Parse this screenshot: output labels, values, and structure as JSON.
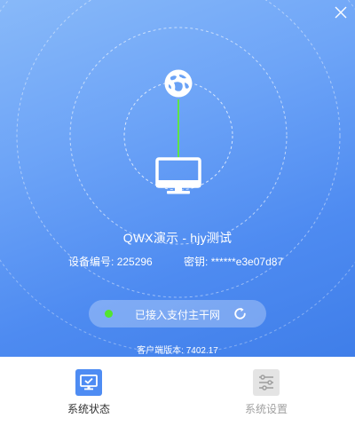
{
  "window": {
    "close_icon": "close-icon"
  },
  "connection": {
    "device_name": "QWX演示 - hjy测试",
    "device_id_label": "设备编号:",
    "device_id_value": "225296",
    "key_label": "密钥:",
    "key_value": "******e3e07d87",
    "status_text": "已接入支付主干网",
    "status_color": "#52e52f",
    "link_color": "#5de34a",
    "icons": {
      "network": "globe-icon",
      "device": "monitor-icon",
      "refresh": "refresh-icon"
    }
  },
  "version": {
    "label": "客户端版本:",
    "value": "7402.17"
  },
  "nav": {
    "items": [
      {
        "label": "系统状态",
        "icon": "monitor-check-icon",
        "active": true
      },
      {
        "label": "系统设置",
        "icon": "sliders-icon",
        "active": false
      }
    ]
  },
  "colors": {
    "hero_start": "#88b9f9",
    "hero_end": "#3f7ee9",
    "active_tab": "#4e8cf3",
    "inactive_tab": "#e4e4e4"
  }
}
